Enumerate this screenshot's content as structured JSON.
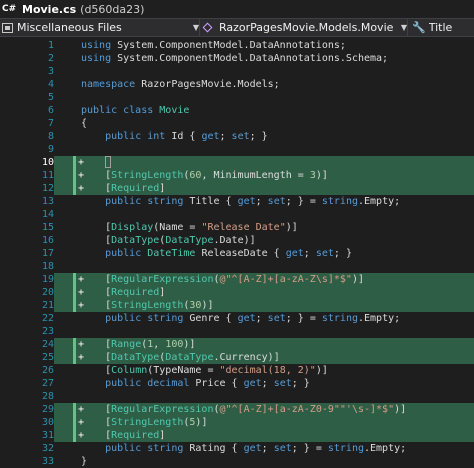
{
  "tab": {
    "icon": "C#",
    "title": "Movie.cs",
    "hash": "(d560da23)"
  },
  "nav": {
    "project": "Miscellaneous Files",
    "type": "RazorPagesMovie.Models.Movie",
    "member": "Title",
    "icons": {
      "project": "file-icon",
      "type": "class-icon",
      "member": "wrench-icon"
    }
  },
  "colors": {
    "keyword": "#569cd6",
    "type": "#4ec9b0",
    "string": "#d69d85",
    "number": "#b5cea8",
    "added_line": "#2f5e46",
    "line_number": "#2b91af"
  },
  "lines": [
    {
      "num": "1",
      "added": false,
      "tokens": [
        [
          "kw",
          "using "
        ],
        [
          "pr",
          "System.ComponentModel.DataAnnotations;"
        ]
      ]
    },
    {
      "num": "2",
      "added": false,
      "tokens": [
        [
          "kw",
          "using "
        ],
        [
          "pr",
          "System.ComponentModel.DataAnnotations.Schema;"
        ]
      ]
    },
    {
      "num": "3",
      "added": false,
      "tokens": []
    },
    {
      "num": "4",
      "added": false,
      "tokens": [
        [
          "kw",
          "namespace "
        ],
        [
          "pr",
          "RazorPagesMovie.Models;"
        ]
      ]
    },
    {
      "num": "5",
      "added": false,
      "tokens": []
    },
    {
      "num": "6",
      "added": false,
      "tokens": [
        [
          "kw",
          "public class "
        ],
        [
          "ty",
          "Movie"
        ]
      ]
    },
    {
      "num": "7",
      "added": false,
      "tokens": [
        [
          "pr",
          "{"
        ]
      ]
    },
    {
      "num": "8",
      "added": false,
      "tokens": [
        [
          "pr",
          "    "
        ],
        [
          "kw",
          "public int "
        ],
        [
          "pr",
          "Id { "
        ],
        [
          "kw",
          "get"
        ],
        [
          "pr",
          "; "
        ],
        [
          "kw",
          "set"
        ],
        [
          "pr",
          "; }"
        ]
      ]
    },
    {
      "num": "9",
      "added": false,
      "tokens": []
    },
    {
      "num": "10",
      "added": true,
      "current": true,
      "tokens": []
    },
    {
      "num": "11",
      "added": true,
      "tokens": [
        [
          "pr",
          "    ["
        ],
        [
          "ty",
          "StringLength"
        ],
        [
          "pr",
          "("
        ],
        [
          "nu",
          "60"
        ],
        [
          "pr",
          ", MinimumLength = "
        ],
        [
          "nu",
          "3"
        ],
        [
          "pr",
          ")]"
        ]
      ]
    },
    {
      "num": "12",
      "added": true,
      "tokens": [
        [
          "pr",
          "    ["
        ],
        [
          "ty",
          "Required"
        ],
        [
          "pr",
          "]"
        ]
      ]
    },
    {
      "num": "13",
      "added": false,
      "tokens": [
        [
          "pr",
          "    "
        ],
        [
          "kw",
          "public string "
        ],
        [
          "pr",
          "Title { "
        ],
        [
          "kw",
          "get"
        ],
        [
          "pr",
          "; "
        ],
        [
          "kw",
          "set"
        ],
        [
          "pr",
          "; } = "
        ],
        [
          "kw",
          "string"
        ],
        [
          "pr",
          ".Empty;"
        ]
      ]
    },
    {
      "num": "14",
      "added": false,
      "tokens": []
    },
    {
      "num": "15",
      "added": false,
      "tokens": [
        [
          "pr",
          "    ["
        ],
        [
          "ty",
          "Display"
        ],
        [
          "pr",
          "(Name = "
        ],
        [
          "st",
          "\"Release Date\""
        ],
        [
          "pr",
          ")]"
        ]
      ]
    },
    {
      "num": "16",
      "added": false,
      "tokens": [
        [
          "pr",
          "    ["
        ],
        [
          "ty",
          "DataType"
        ],
        [
          "pr",
          "("
        ],
        [
          "ty",
          "DataType"
        ],
        [
          "pr",
          ".Date)]"
        ]
      ]
    },
    {
      "num": "17",
      "added": false,
      "tokens": [
        [
          "pr",
          "    "
        ],
        [
          "kw",
          "public "
        ],
        [
          "ty",
          "DateTime "
        ],
        [
          "pr",
          "ReleaseDate { "
        ],
        [
          "kw",
          "get"
        ],
        [
          "pr",
          "; "
        ],
        [
          "kw",
          "set"
        ],
        [
          "pr",
          "; }"
        ]
      ]
    },
    {
      "num": "18",
      "added": false,
      "tokens": []
    },
    {
      "num": "19",
      "added": true,
      "tokens": [
        [
          "pr",
          "    ["
        ],
        [
          "ty",
          "RegularExpression"
        ],
        [
          "pr",
          "("
        ],
        [
          "st",
          "@\"^[A-Z]+[a-zA-Z\\s]*$\""
        ],
        [
          "pr",
          ")]"
        ]
      ]
    },
    {
      "num": "20",
      "added": true,
      "tokens": [
        [
          "pr",
          "    ["
        ],
        [
          "ty",
          "Required"
        ],
        [
          "pr",
          "]"
        ]
      ]
    },
    {
      "num": "21",
      "added": true,
      "tokens": [
        [
          "pr",
          "    ["
        ],
        [
          "ty",
          "StringLength"
        ],
        [
          "pr",
          "("
        ],
        [
          "nu",
          "30"
        ],
        [
          "pr",
          ")]"
        ]
      ]
    },
    {
      "num": "22",
      "added": false,
      "tokens": [
        [
          "pr",
          "    "
        ],
        [
          "kw",
          "public string "
        ],
        [
          "pr",
          "Genre { "
        ],
        [
          "kw",
          "get"
        ],
        [
          "pr",
          "; "
        ],
        [
          "kw",
          "set"
        ],
        [
          "pr",
          "; } = "
        ],
        [
          "kw",
          "string"
        ],
        [
          "pr",
          ".Empty;"
        ]
      ]
    },
    {
      "num": "23",
      "added": false,
      "tokens": []
    },
    {
      "num": "24",
      "added": true,
      "tokens": [
        [
          "pr",
          "    ["
        ],
        [
          "ty",
          "Range"
        ],
        [
          "pr",
          "("
        ],
        [
          "nu",
          "1"
        ],
        [
          "pr",
          ", "
        ],
        [
          "nu",
          "100"
        ],
        [
          "pr",
          ")]"
        ]
      ]
    },
    {
      "num": "25",
      "added": true,
      "tokens": [
        [
          "pr",
          "    ["
        ],
        [
          "ty",
          "DataType"
        ],
        [
          "pr",
          "("
        ],
        [
          "ty",
          "DataType"
        ],
        [
          "pr",
          ".Currency)]"
        ]
      ]
    },
    {
      "num": "26",
      "added": false,
      "tokens": [
        [
          "pr",
          "    ["
        ],
        [
          "ty",
          "Column"
        ],
        [
          "pr",
          "(TypeName = "
        ],
        [
          "st",
          "\"decimal(18, 2)\""
        ],
        [
          "pr",
          ")]"
        ]
      ]
    },
    {
      "num": "27",
      "added": false,
      "tokens": [
        [
          "pr",
          "    "
        ],
        [
          "kw",
          "public decimal "
        ],
        [
          "pr",
          "Price { "
        ],
        [
          "kw",
          "get"
        ],
        [
          "pr",
          "; "
        ],
        [
          "kw",
          "set"
        ],
        [
          "pr",
          "; }"
        ]
      ]
    },
    {
      "num": "28",
      "added": false,
      "tokens": []
    },
    {
      "num": "29",
      "added": true,
      "tokens": [
        [
          "pr",
          "    ["
        ],
        [
          "ty",
          "RegularExpression"
        ],
        [
          "pr",
          "("
        ],
        [
          "st",
          "@\"^[A-Z]+[a-zA-Z0-9\"\"'\\s-]*$\""
        ],
        [
          "pr",
          ")]"
        ]
      ]
    },
    {
      "num": "30",
      "added": true,
      "tokens": [
        [
          "pr",
          "    ["
        ],
        [
          "ty",
          "StringLength"
        ],
        [
          "pr",
          "("
        ],
        [
          "nu",
          "5"
        ],
        [
          "pr",
          ")]"
        ]
      ]
    },
    {
      "num": "31",
      "added": true,
      "tokens": [
        [
          "pr",
          "    ["
        ],
        [
          "ty",
          "Required"
        ],
        [
          "pr",
          "]"
        ]
      ]
    },
    {
      "num": "32",
      "added": false,
      "tokens": [
        [
          "pr",
          "    "
        ],
        [
          "kw",
          "public string "
        ],
        [
          "pr",
          "Rating { "
        ],
        [
          "kw",
          "get"
        ],
        [
          "pr",
          "; "
        ],
        [
          "kw",
          "set"
        ],
        [
          "pr",
          "; } = "
        ],
        [
          "kw",
          "string"
        ],
        [
          "pr",
          ".Empty;"
        ]
      ]
    },
    {
      "num": "33",
      "added": false,
      "tokens": [
        [
          "pr",
          "}"
        ]
      ]
    }
  ]
}
